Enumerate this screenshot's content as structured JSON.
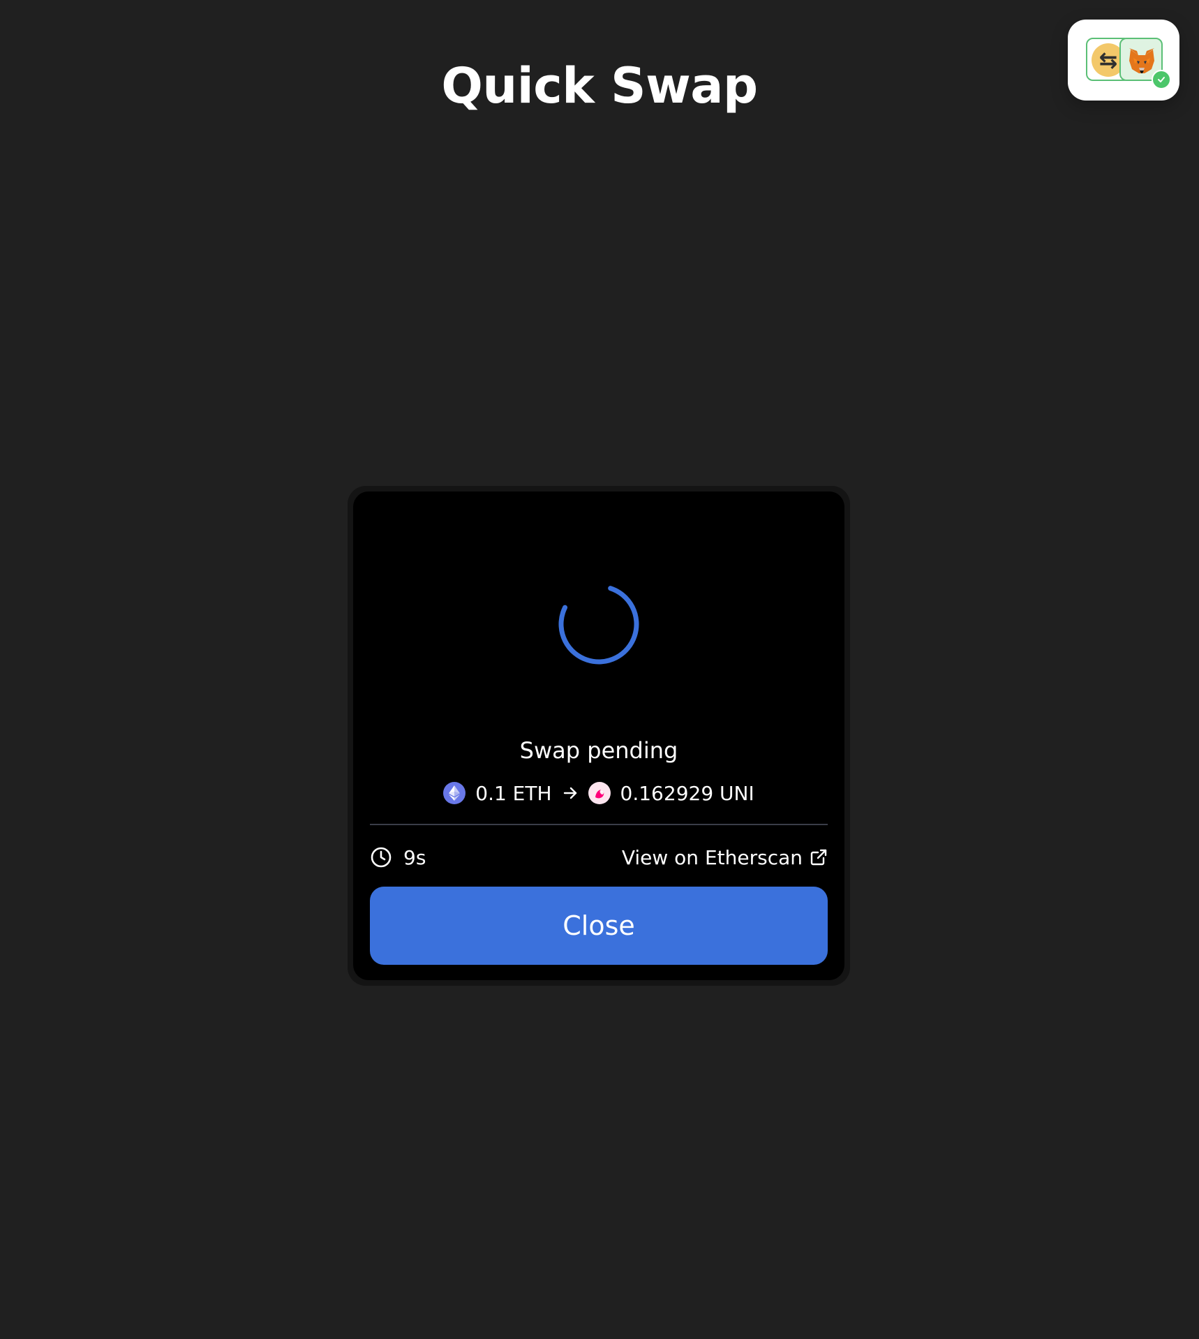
{
  "header": {
    "title": "Quick Swap"
  },
  "wallet_widget": {
    "swap_icon": "swap-arrows-icon",
    "wallet_icon": "metamask-fox-icon",
    "status_icon": "check-icon",
    "swap_glyph": "⇆"
  },
  "modal": {
    "status_title": "Swap pending",
    "from": {
      "amount": "0.1 ETH",
      "icon": "eth-icon"
    },
    "to": {
      "amount": "0.162929 UNI",
      "icon": "uni-icon"
    },
    "elapsed": "9s",
    "etherscan_link": "View on Etherscan",
    "close_label": "Close"
  },
  "colors": {
    "background": "#202020",
    "modal": "#000000",
    "accent": "#3b71dc",
    "success": "#4cc66a"
  }
}
